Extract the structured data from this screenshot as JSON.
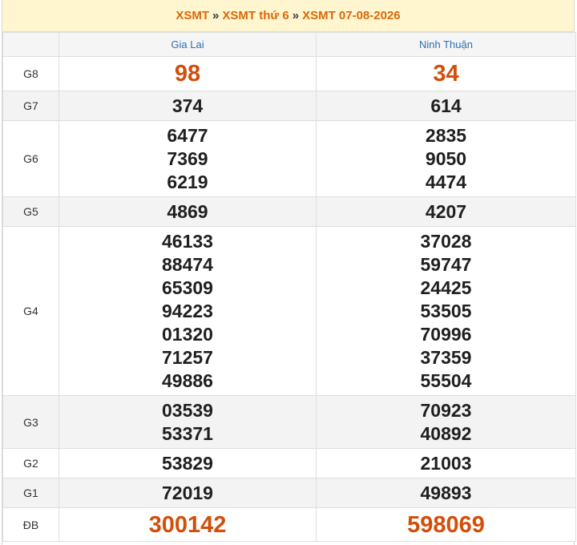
{
  "breadcrumb": {
    "part1": "XSMT",
    "sep1": "»",
    "part2": "XSMT thứ 6",
    "sep2": "»",
    "part3": "XSMT 07-08-2026"
  },
  "columns": [
    "Gia Lai",
    "Ninh Thuận"
  ],
  "prizes": [
    {
      "label": "G8",
      "gia_lai": [
        "98"
      ],
      "ninh_thuan": [
        "34"
      ]
    },
    {
      "label": "G7",
      "gia_lai": [
        "374"
      ],
      "ninh_thuan": [
        "614"
      ]
    },
    {
      "label": "G6",
      "gia_lai": [
        "6477",
        "7369",
        "6219"
      ],
      "ninh_thuan": [
        "2835",
        "9050",
        "4474"
      ]
    },
    {
      "label": "G5",
      "gia_lai": [
        "4869"
      ],
      "ninh_thuan": [
        "4207"
      ]
    },
    {
      "label": "G4",
      "gia_lai": [
        "46133",
        "88474",
        "65309",
        "94223",
        "01320",
        "71257",
        "49886"
      ],
      "ninh_thuan": [
        "37028",
        "59747",
        "24425",
        "53505",
        "70996",
        "37359",
        "55504"
      ]
    },
    {
      "label": "G3",
      "gia_lai": [
        "03539",
        "53371"
      ],
      "ninh_thuan": [
        "70923",
        "40892"
      ]
    },
    {
      "label": "G2",
      "gia_lai": [
        "53829"
      ],
      "ninh_thuan": [
        "21003"
      ]
    },
    {
      "label": "G1",
      "gia_lai": [
        "72019"
      ],
      "ninh_thuan": [
        "49893"
      ]
    },
    {
      "label": "ĐB",
      "gia_lai": [
        "300142"
      ],
      "ninh_thuan": [
        "598069"
      ]
    }
  ],
  "colors": {
    "accent_orange": "#d9680b",
    "prize_red": "#d14f0a",
    "province_blue": "#2d6fb0",
    "header_bg": "#fff6cf"
  }
}
